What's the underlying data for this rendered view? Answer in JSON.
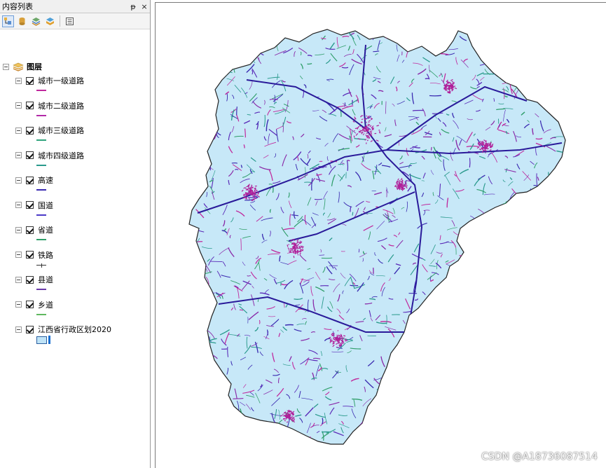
{
  "toc": {
    "title": "内容列表",
    "pin_glyph": "ᵽ",
    "close_glyph": "×",
    "root_label": "图层",
    "toolbar_icons": [
      "list-by-drawing-order-icon",
      "list-by-source-icon",
      "list-by-visibility-icon",
      "list-by-selection-icon",
      "options-icon"
    ],
    "layers": [
      {
        "label": "城市一级道路",
        "color": "#c0289c"
      },
      {
        "label": "城市二级道路",
        "color": "#b22aa8"
      },
      {
        "label": "城市三级道路",
        "color": "#2fa37c"
      },
      {
        "label": "城市四级道路",
        "color": "#2a9a8c"
      },
      {
        "label": "高速",
        "color": "#3a2ab0"
      },
      {
        "label": "国道",
        "color": "#4b3ac8"
      },
      {
        "label": "省道",
        "color": "#2f9e6a"
      },
      {
        "label": "铁路",
        "color": "#333333"
      },
      {
        "label": "县道",
        "color": "#6a3aa8"
      },
      {
        "label": "乡道",
        "color": "#5fb85f"
      },
      {
        "label": "江西省行政区划2020",
        "color": "#bfe3f7"
      }
    ]
  },
  "map": {
    "fill_color": "#c7e8f8",
    "border_color": "#222222"
  },
  "watermark": "CSDN @A18736087514"
}
